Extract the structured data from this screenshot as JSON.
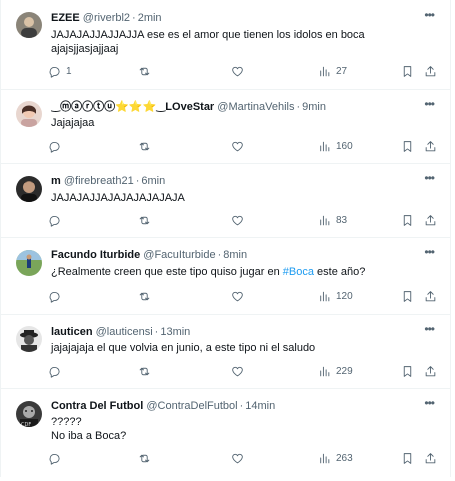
{
  "colors": {
    "text": "#0f1419",
    "secondary": "#536471",
    "link": "#1d9bf0",
    "divider": "#eff3f4"
  },
  "icons": {
    "more": "more-horizontal-icon",
    "reply": "reply-bubble-icon",
    "retweet": "retweet-icon",
    "like": "heart-icon",
    "views": "bar-chart-icon",
    "bookmark": "bookmark-icon",
    "share": "share-upload-icon"
  },
  "tweets": [
    {
      "display_name": "EZEE",
      "handle": "@riverbl2",
      "time": "2min",
      "lines": [
        "JAJAJAJJAJJAJJA ese es el amor que tienen los idolos en boca",
        "ajajsjjasjajjaaj"
      ],
      "replies": "1",
      "retweets": "",
      "likes": "",
      "views": "27"
    },
    {
      "display_name": "‿ⓜⓐⓡⓣⓤ⭐⭐⭐‿LOveStar",
      "handle": "@MartinaVehils",
      "time": "9min",
      "lines": [
        "Jajajajaa"
      ],
      "replies": "",
      "retweets": "",
      "likes": "",
      "views": "160"
    },
    {
      "display_name": "m",
      "handle": "@firebreath21",
      "time": "6min",
      "lines": [
        "JAJAJAJJAJAJAJAJAJAJA"
      ],
      "replies": "",
      "retweets": "",
      "likes": "",
      "views": "83"
    },
    {
      "display_name": "Facundo Iturbide",
      "handle": "@FacuIturbide",
      "time": "8min",
      "text_before": "¿Realmente creen que este tipo quiso jugar en ",
      "hashtag": "#Boca",
      "text_after": " este año?",
      "replies": "",
      "retweets": "",
      "likes": "",
      "views": "120"
    },
    {
      "display_name": "lauticen",
      "handle": "@lauticensi",
      "time": "13min",
      "lines": [
        "jajajajaja el que volvia en junio, a este tipo ni el saludo"
      ],
      "replies": "",
      "retweets": "",
      "likes": "",
      "views": "229"
    },
    {
      "display_name": "Contra Del Futbol",
      "handle": "@ContraDelFutbol",
      "time": "14min",
      "lines": [
        "?????",
        "No iba a Boca?"
      ],
      "replies": "",
      "retweets": "",
      "likes": "",
      "views": "263"
    }
  ]
}
